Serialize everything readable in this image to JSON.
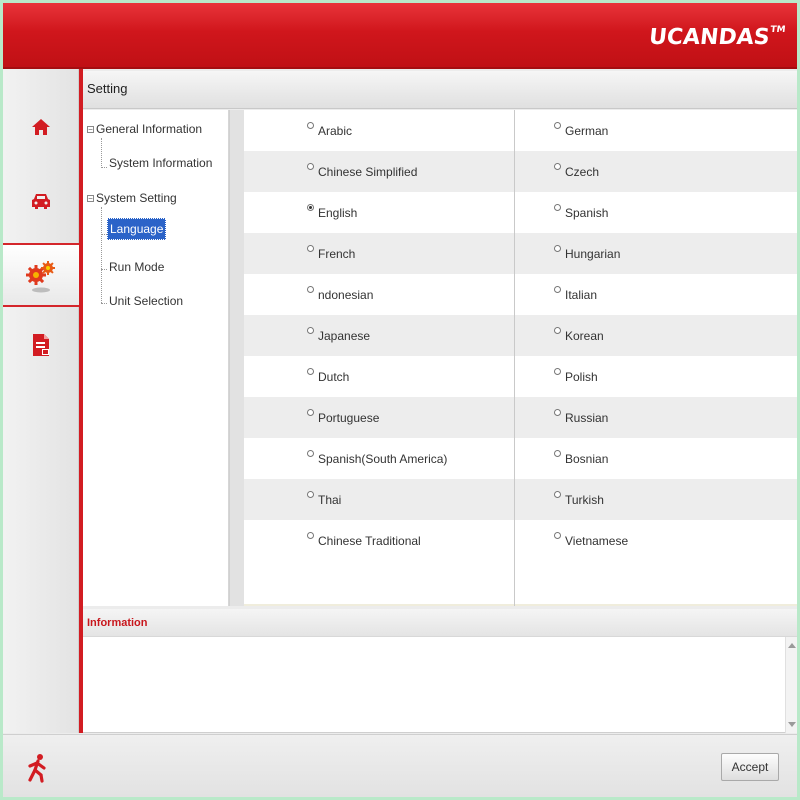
{
  "header": {
    "logo_text": "UCANDAS",
    "logo_tm": "TM"
  },
  "sidebar": {
    "items": [
      {
        "name": "home",
        "icon": "home-icon"
      },
      {
        "name": "vehicle",
        "icon": "car-icon"
      },
      {
        "name": "settings",
        "icon": "gear-icon",
        "active": true
      },
      {
        "name": "report",
        "icon": "document-icon"
      }
    ]
  },
  "page": {
    "title": "Setting"
  },
  "tree": {
    "nodes": {
      "general": "General Information",
      "system_info": "System Information",
      "system_setting": "System Setting",
      "language": "Language",
      "run_mode": "Run Mode",
      "unit_selection": "Unit Selection"
    },
    "selected": "language"
  },
  "languages": {
    "left": [
      "Arabic",
      "Chinese Simplified",
      "English",
      "French",
      "ndonesian",
      "Japanese",
      "Dutch",
      "Portuguese",
      "Spanish(South America)",
      "Thai",
      "Chinese Traditional"
    ],
    "right": [
      "German",
      "Czech",
      "Spanish",
      "Hungarian",
      "Italian",
      "Korean",
      "Polish",
      "Russian",
      "Bosnian",
      "Turkish",
      "Vietnamese"
    ],
    "selected": "English"
  },
  "info": {
    "title": "Information"
  },
  "footer": {
    "accept_label": "Accept",
    "exit_icon": "exit-icon"
  },
  "colors": {
    "brand_red": "#d21c22",
    "selection_blue": "#2b63c8"
  }
}
